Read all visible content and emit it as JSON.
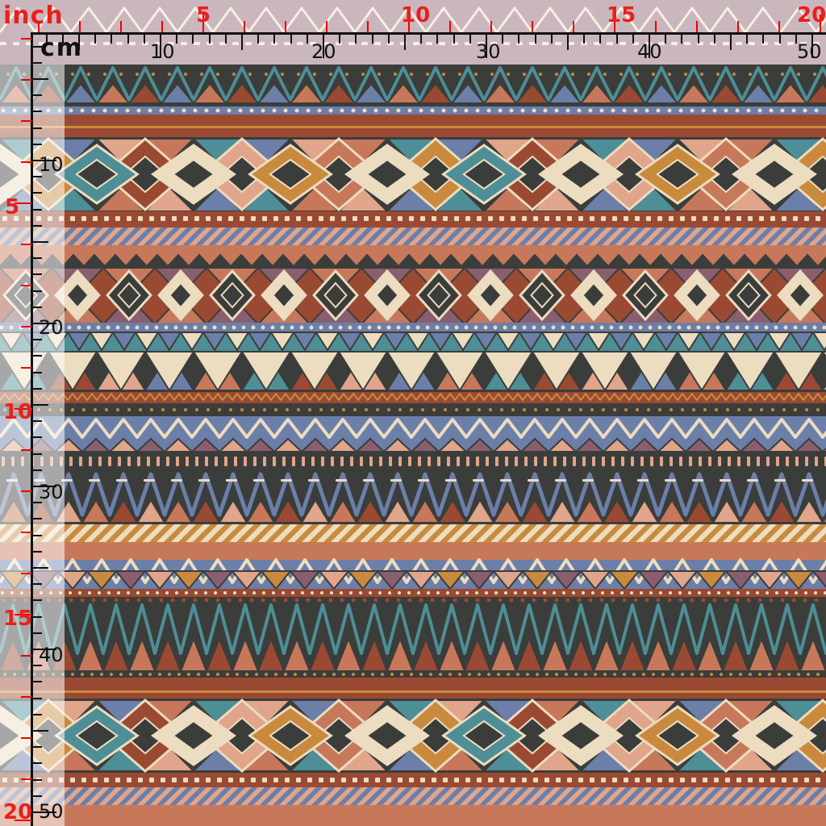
{
  "ruler": {
    "inch_unit": "inch",
    "cm_unit": "cm",
    "inch_labels": [
      "5",
      "10",
      "15",
      "20"
    ],
    "cm_labels": [
      "10",
      "20",
      "30",
      "40",
      "50"
    ],
    "inch_labels_left": [
      "5",
      "10",
      "15",
      "20"
    ],
    "cm_labels_left": [
      "10",
      "20",
      "30",
      "40",
      "50"
    ]
  },
  "colors": {
    "ink": "#111111",
    "inch_red": "#e8201c",
    "charcoal": "#3b3d3b",
    "rust": "#9a4a32",
    "terracotta": "#c8785a",
    "peach": "#e0a58a",
    "teal": "#4e8e96",
    "slate_blue": "#6b7fa8",
    "cream": "#ecdcc0",
    "ochre": "#c98a3e",
    "plum": "#8a5e6e"
  }
}
